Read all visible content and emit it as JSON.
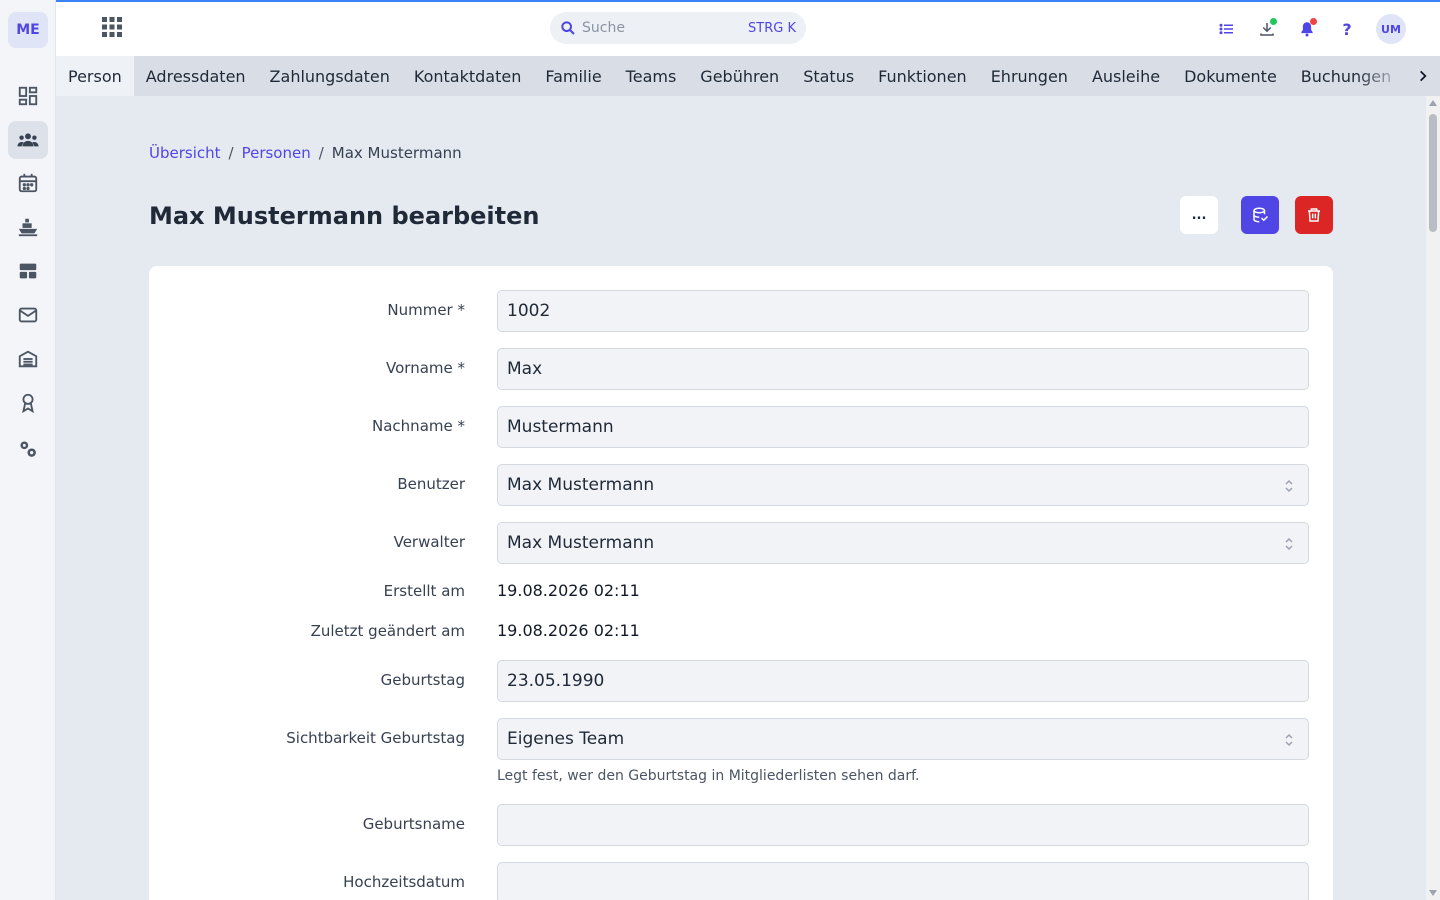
{
  "app": {
    "logo_text": "ME",
    "accent_color": "#4f46e5",
    "danger_color": "#dc2626"
  },
  "sidebar": {
    "items": [
      {
        "icon": "dashboard-icon",
        "active": false
      },
      {
        "icon": "people-icon",
        "active": true
      },
      {
        "icon": "calendar-icon",
        "active": false
      },
      {
        "icon": "ship-icon",
        "active": false
      },
      {
        "icon": "table-icon",
        "active": false
      },
      {
        "icon": "mail-icon",
        "active": false
      },
      {
        "icon": "warehouse-icon",
        "active": false
      },
      {
        "icon": "award-icon",
        "active": false
      },
      {
        "icon": "settings-icon",
        "active": false
      }
    ]
  },
  "topbar": {
    "search_placeholder": "Suche",
    "search_shortcut": "STRG K",
    "avatar_initials": "UM",
    "icons": [
      "list-icon",
      "download-icon",
      "bell-icon",
      "help-icon"
    ]
  },
  "tabs": [
    {
      "label": "Person",
      "active": true
    },
    {
      "label": "Adressdaten"
    },
    {
      "label": "Zahlungsdaten"
    },
    {
      "label": "Kontaktdaten"
    },
    {
      "label": "Familie"
    },
    {
      "label": "Teams"
    },
    {
      "label": "Gebühren"
    },
    {
      "label": "Status"
    },
    {
      "label": "Funktionen"
    },
    {
      "label": "Ehrungen"
    },
    {
      "label": "Ausleihe"
    },
    {
      "label": "Dokumente"
    },
    {
      "label": "Buchungen"
    }
  ],
  "breadcrumb": {
    "items": [
      "Übersicht",
      "Personen"
    ],
    "separator": "/",
    "current": "Max Mustermann"
  },
  "page": {
    "title": "Max Mustermann bearbeiten",
    "more_label": "..."
  },
  "form": {
    "nummer": {
      "label": "Nummer *",
      "value": "1002"
    },
    "vorname": {
      "label": "Vorname *",
      "value": "Max"
    },
    "nachname": {
      "label": "Nachname *",
      "value": "Mustermann"
    },
    "benutzer": {
      "label": "Benutzer",
      "value": "Max Mustermann"
    },
    "verwalter": {
      "label": "Verwalter",
      "value": "Max Mustermann"
    },
    "erstellt": {
      "label": "Erstellt am",
      "value": "19.08.2026 02:11"
    },
    "geaendert": {
      "label": "Zuletzt geändert am",
      "value": "19.08.2026 02:11"
    },
    "geburtstag": {
      "label": "Geburtstag",
      "value": "23.05.1990"
    },
    "sichtbarkeit": {
      "label": "Sichtbarkeit Geburtstag",
      "value": "Eigenes Team",
      "hint": "Legt fest, wer den Geburtstag in Mitgliederlisten sehen darf."
    },
    "geburtsname": {
      "label": "Geburtsname",
      "value": ""
    },
    "hochzeitsdatum": {
      "label": "Hochzeitsdatum",
      "value": ""
    }
  }
}
